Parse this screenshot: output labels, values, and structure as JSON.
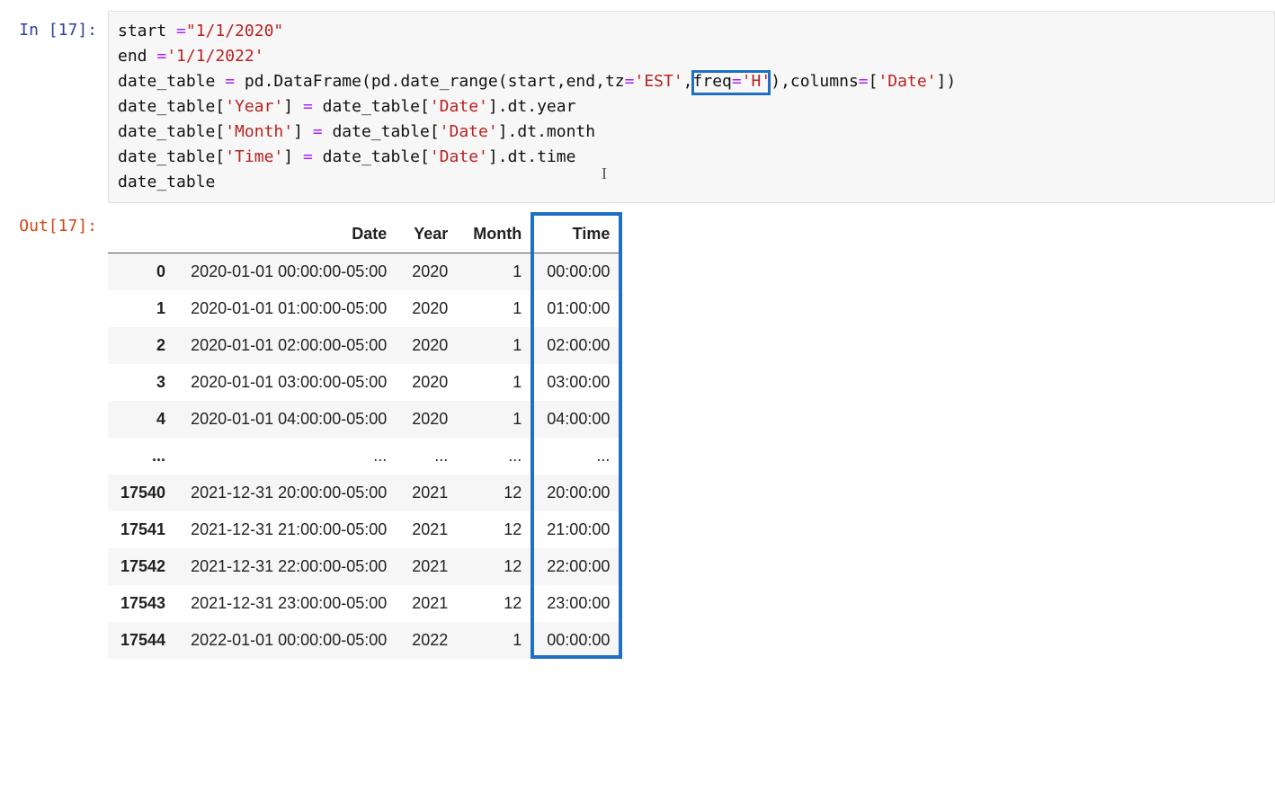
{
  "in_prompt": "In [17]:",
  "out_prompt": "Out[17]:",
  "code": {
    "l1_var": "start ",
    "l1_op": "=",
    "l1_str": "\"1/1/2020\"",
    "l2_var": "end ",
    "l2_op": "=",
    "l2_str": "'1/1/2022'",
    "l3_a": "date_table ",
    "l3_op": "=",
    "l3_b": " pd",
    "l3_dot1": ".",
    "l3_fn1": "DataFrame",
    "l3_p1": "(",
    "l3_c": "pd",
    "l3_dot2": ".",
    "l3_fn2": "date_range",
    "l3_p2": "(",
    "l3_d": "start",
    "l3_com1": ",",
    "l3_e": "end",
    "l3_com2": ",",
    "l3_f": "tz",
    "l3_eq1": "=",
    "l3_s1": "'EST'",
    "l3_com3": ",",
    "l3_g": "freq",
    "l3_eq2": "=",
    "l3_s2": "'H'",
    "l3_p3": ")",
    "l3_com4": ",",
    "l3_h": "columns",
    "l3_eq3": "=",
    "l3_br1": "[",
    "l3_s3": "'Date'",
    "l3_br2": "])",
    "l4_a": "date_table",
    "l4_br1": "[",
    "l4_s1": "'Year'",
    "l4_br2": "] ",
    "l4_op": "=",
    "l4_b": " date_table",
    "l4_br3": "[",
    "l4_s2": "'Date'",
    "l4_br4": "]",
    "l4_dot": ".",
    "l4_c": "dt",
    "l4_dot2": ".",
    "l4_d": "year",
    "l5_a": "date_table",
    "l5_br1": "[",
    "l5_s1": "'Month'",
    "l5_br2": "] ",
    "l5_op": "=",
    "l5_b": " date_table",
    "l5_br3": "[",
    "l5_s2": "'Date'",
    "l5_br4": "]",
    "l5_dot": ".",
    "l5_c": "dt",
    "l5_dot2": ".",
    "l5_d": "month",
    "l6_a": "date_table",
    "l6_br1": "[",
    "l6_s1": "'Time'",
    "l6_br2": "] ",
    "l6_op": "=",
    "l6_b": " date_table",
    "l6_br3": "[",
    "l6_s2": "'Date'",
    "l6_br4": "]",
    "l6_dot": ".",
    "l6_c": "dt",
    "l6_dot2": ".",
    "l6_d": "time",
    "l7": "date_table"
  },
  "columns": [
    "Date",
    "Year",
    "Month",
    "Time"
  ],
  "ellipsis": "...",
  "rows_top": [
    {
      "idx": "0",
      "date": "2020-01-01 00:00:00-05:00",
      "year": "2020",
      "month": "1",
      "time": "00:00:00"
    },
    {
      "idx": "1",
      "date": "2020-01-01 01:00:00-05:00",
      "year": "2020",
      "month": "1",
      "time": "01:00:00"
    },
    {
      "idx": "2",
      "date": "2020-01-01 02:00:00-05:00",
      "year": "2020",
      "month": "1",
      "time": "02:00:00"
    },
    {
      "idx": "3",
      "date": "2020-01-01 03:00:00-05:00",
      "year": "2020",
      "month": "1",
      "time": "03:00:00"
    },
    {
      "idx": "4",
      "date": "2020-01-01 04:00:00-05:00",
      "year": "2020",
      "month": "1",
      "time": "04:00:00"
    }
  ],
  "rows_bottom": [
    {
      "idx": "17540",
      "date": "2021-12-31 20:00:00-05:00",
      "year": "2021",
      "month": "12",
      "time": "20:00:00"
    },
    {
      "idx": "17541",
      "date": "2021-12-31 21:00:00-05:00",
      "year": "2021",
      "month": "12",
      "time": "21:00:00"
    },
    {
      "idx": "17542",
      "date": "2021-12-31 22:00:00-05:00",
      "year": "2021",
      "month": "12",
      "time": "22:00:00"
    },
    {
      "idx": "17543",
      "date": "2021-12-31 23:00:00-05:00",
      "year": "2021",
      "month": "12",
      "time": "23:00:00"
    },
    {
      "idx": "17544",
      "date": "2022-01-01 00:00:00-05:00",
      "year": "2022",
      "month": "1",
      "time": "00:00:00"
    }
  ],
  "ibeam_glyph": "I"
}
